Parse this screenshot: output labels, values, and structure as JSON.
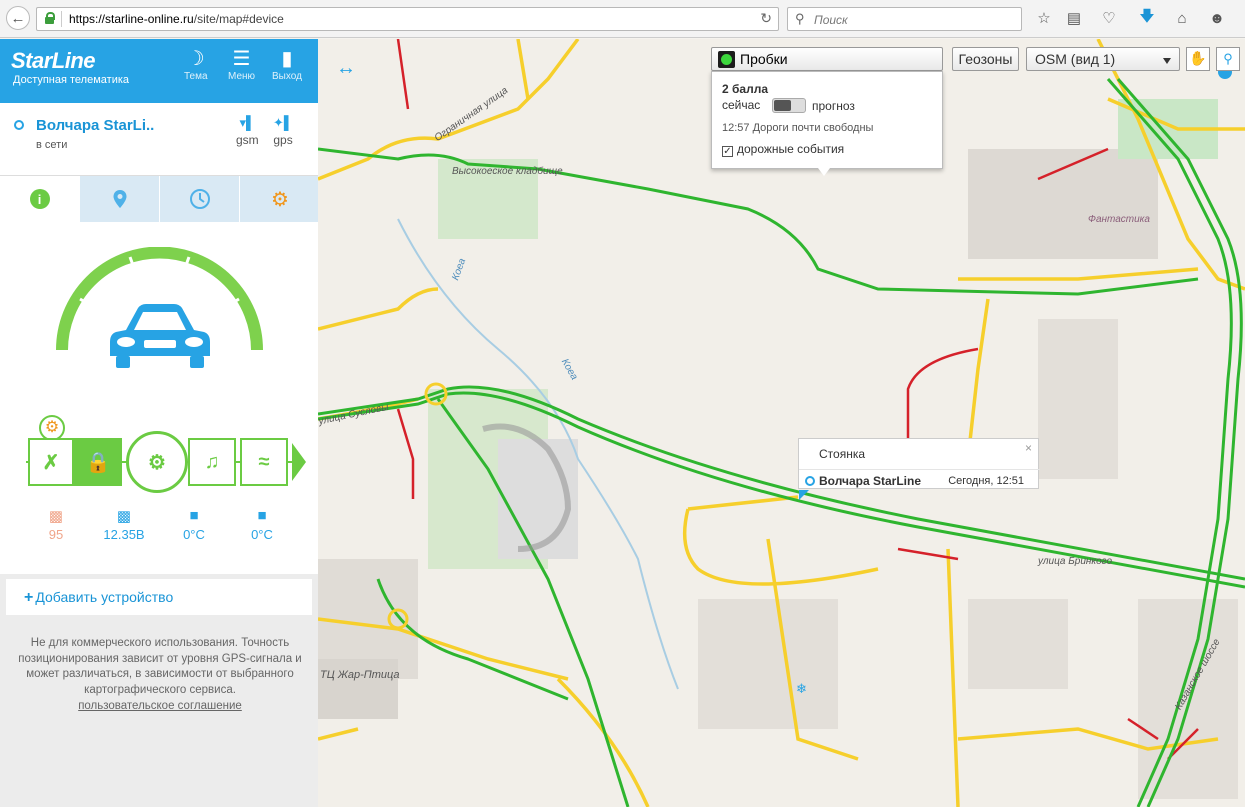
{
  "browser": {
    "url_domain": "https://starline-online.ru",
    "url_path": "/site/map#device",
    "search_placeholder": "Поиск"
  },
  "header": {
    "logo": "StarLine",
    "tagline": "Доступная телематика",
    "theme_label": "Тема",
    "menu_label": "Меню",
    "exit_label": "Выход"
  },
  "device": {
    "name": "Волчара StarLi..",
    "status": "в сети",
    "gsm_label": "gsm",
    "gps_label": "gps"
  },
  "readouts": {
    "fuel": "95",
    "battery": "12.35B",
    "cabin_temp": "0°C",
    "engine_temp": "0°C"
  },
  "add_device": "Добавить устройство",
  "disclaimer": "Не для коммерческого использования. Точность позиционирования зависит от уровня GPS-сигнала и может различаться, в зависимости от выбранного картографического сервиса.",
  "agreement_link": "пользовательское соглашение",
  "map": {
    "traffic_label": "Пробки",
    "traffic_score": "2 балла",
    "traffic_now": "сейчас",
    "traffic_forecast": "прогноз",
    "traffic_condition": "12:57 Дороги почти свободны",
    "traffic_events": "дорожные события",
    "geozones": "Геозоны",
    "map_type": "OSM (вид 1)",
    "labels": {
      "cemetery": "Высокоеское кладбище",
      "street1": "Ограничная улица",
      "river1": "Коеа",
      "river2": "Коеа",
      "fantastika": "Фантастика",
      "street2": "улица Бринкого",
      "road": "Казанское шоссе",
      "mall": "ТЦ Жар-Птица",
      "street3": "улица Сусловы"
    }
  },
  "popup": {
    "title": "Стоянка",
    "device": "Волчара StarLine",
    "time": "Сегодня, 12:51"
  }
}
